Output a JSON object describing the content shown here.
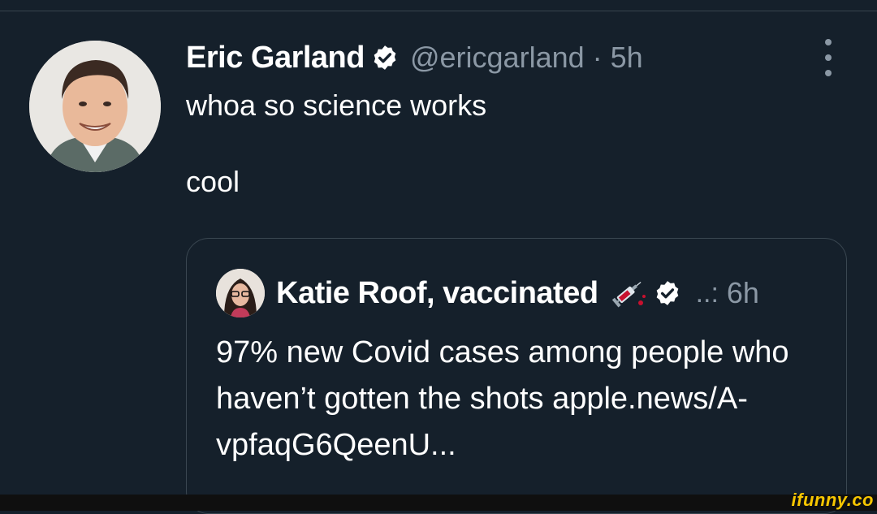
{
  "tweet": {
    "author_name": "Eric Garland",
    "handle": "@ericgarland",
    "separator": "·",
    "time": "5h",
    "text": "whoa so science works\n\ncool"
  },
  "quote": {
    "author_name": "Katie Roof, vaccinated",
    "handle": "..:",
    "time": "6h",
    "text": "97% new Covid cases among people who haven’t gotten the shots apple.news/A-vpfaqG6QeenU..."
  },
  "watermark": "ifunny.co",
  "colors": {
    "background": "#15202b",
    "muted_text": "#8b98a5",
    "border": "#38444d",
    "watermark": "#f7c600"
  }
}
